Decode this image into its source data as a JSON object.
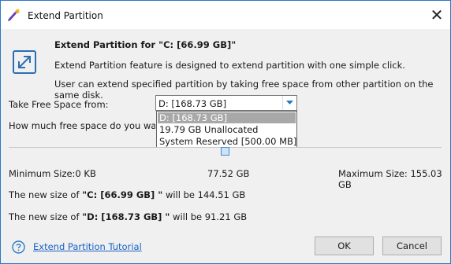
{
  "window": {
    "title": "Extend Partition",
    "close_glyph": "✕"
  },
  "header": {
    "title": "Extend Partition for \"C: [66.99 GB]\"",
    "line1": "Extend Partition feature is designed to extend partition with one simple click.",
    "line2": "User can extend specified partition by taking free space from other partition on the same disk."
  },
  "take_from": {
    "label": "Take Free Space from:",
    "selected": "D:  [168.73 GB]",
    "options": [
      "D:  [168.73 GB]",
      "19.79 GB Unallocated",
      "System Reserved [500.00 MB]"
    ]
  },
  "how_much": {
    "label": "How much free space do you want to take?"
  },
  "slider": {
    "min_label": "Minimum Size:0 KB",
    "current_label": "77.52 GB",
    "max_label": "Maximum Size: 155.03 GB"
  },
  "new_size_c": {
    "prefix": "The new size of ",
    "part": "\"C: [66.99 GB] \"",
    "suffix": " will be 144.51 GB"
  },
  "new_size_d": {
    "prefix": "The new size of ",
    "part": "\"D: [168.73 GB] \"",
    "suffix": " will be 91.21 GB"
  },
  "footer": {
    "tutorial_link": "Extend Partition Tutorial",
    "ok": "OK",
    "cancel": "Cancel"
  },
  "colors": {
    "accent": "#2b78c5",
    "link": "#1a62c6",
    "selected_item": "#a8a8a8"
  },
  "icons": {
    "app": "partition-wizard-icon",
    "feature": "extend-arrows-icon",
    "help": "help-icon"
  }
}
